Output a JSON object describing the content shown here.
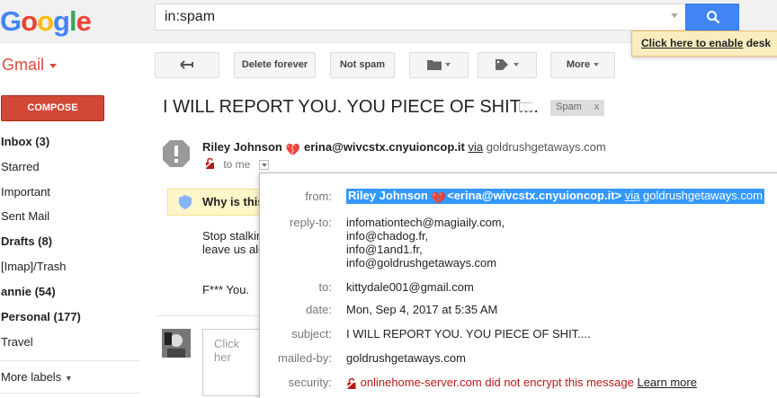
{
  "header": {
    "logo_letters": [
      {
        "ch": "G",
        "color": "#4285f4"
      },
      {
        "ch": "o",
        "color": "#ea4335"
      },
      {
        "ch": "o",
        "color": "#fbbc05"
      },
      {
        "ch": "g",
        "color": "#4285f4"
      },
      {
        "ch": "l",
        "color": "#34a853"
      },
      {
        "ch": "e",
        "color": "#ea4335"
      }
    ],
    "search_value": "in:spam",
    "desktop_banner_link": "Click here to enable",
    "desktop_banner_rest": "desk"
  },
  "app": {
    "name": "Gmail"
  },
  "toolbar": {
    "delete_forever": "Delete forever",
    "not_spam": "Not spam",
    "more": "More"
  },
  "sidebar": {
    "compose": "COMPOSE",
    "items": [
      {
        "label": "Inbox (3)",
        "bold": true
      },
      {
        "label": "Starred",
        "bold": false
      },
      {
        "label": "Important",
        "bold": false
      },
      {
        "label": "Sent Mail",
        "bold": false
      },
      {
        "label": "Drafts (8)",
        "bold": true
      },
      {
        "label": "[Imap]/Trash",
        "bold": false
      },
      {
        "label": "annie (54)",
        "bold": true
      },
      {
        "label": "Personal (177)",
        "bold": true
      },
      {
        "label": "Travel",
        "bold": false
      }
    ],
    "more_labels": "More labels"
  },
  "message": {
    "subject": "I WILL REPORT YOU. YOU PIECE OF SHIT....",
    "spam_chip": "Spam",
    "spam_chip_close": "x",
    "sender_name": "Riley Johnson",
    "sender_email": "erina@wivcstx.cnyuioncop.it",
    "via": "via",
    "via_domain": "goldrushgetaways.com",
    "to": "to me",
    "why_label": "Why is this",
    "body_line1": "Stop stalkin",
    "body_line2": "leave us alo",
    "body_line3": "F*** You.",
    "reply_placeholder": "Click her"
  },
  "details": {
    "from_label": "from:",
    "from_name": "Riley Johnson",
    "from_email": "<erina@wivcstx.cnyuioncop.it>",
    "from_via": "via",
    "from_via_domain": "goldrushgetaways.com",
    "reply_to_label": "reply-to:",
    "reply_to": [
      "infomationtech@magiaily.com,",
      "info@chadog.fr,",
      "info@1and1.fr,",
      "info@goldrushgetaways.com"
    ],
    "to_label": "to:",
    "to_value": "kittydale001@gmail.com",
    "date_label": "date:",
    "date_value": "Mon, Sep 4, 2017 at 5:35 AM",
    "subject_label": "subject:",
    "subject_value": "I WILL REPORT YOU. YOU PIECE OF SHIT....",
    "mailed_by_label": "mailed-by:",
    "mailed_by_value": "goldrushgetaways.com",
    "security_label": "security:",
    "security_value": "onlinehome-server.com did not encrypt this message",
    "learn_more": "Learn more"
  },
  "colors": {
    "accent_red": "#dd4b39",
    "compose_red": "#d14836",
    "search_blue": "#4285f4",
    "highlight_blue": "#3399ff",
    "security_red": "#b8191a"
  },
  "icons": {
    "back": "arrow-left-icon",
    "folder": "folder-icon",
    "tag": "tag-icon",
    "search": "search-icon",
    "warning": "exclamation-octagon-icon",
    "shield": "shield-icon",
    "heart": "heart-icon",
    "unencrypted": "red-lock-icon"
  }
}
